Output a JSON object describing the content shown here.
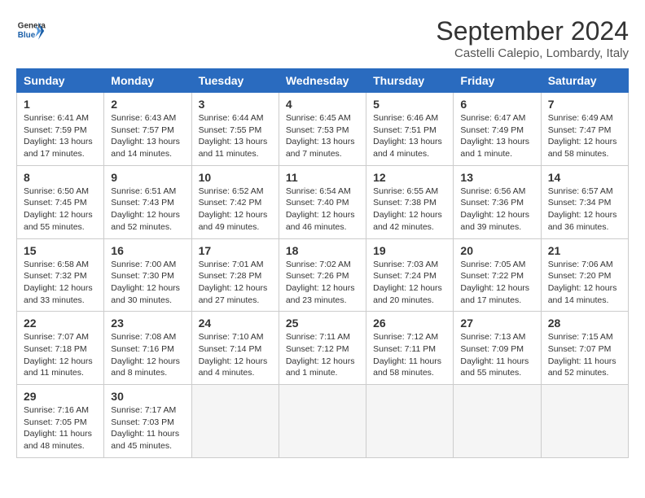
{
  "header": {
    "logo_line1": "General",
    "logo_line2": "Blue",
    "month": "September 2024",
    "location": "Castelli Calepio, Lombardy, Italy"
  },
  "columns": [
    "Sunday",
    "Monday",
    "Tuesday",
    "Wednesday",
    "Thursday",
    "Friday",
    "Saturday"
  ],
  "weeks": [
    [
      {
        "day": "1",
        "info": "Sunrise: 6:41 AM\nSunset: 7:59 PM\nDaylight: 13 hours\nand 17 minutes."
      },
      {
        "day": "2",
        "info": "Sunrise: 6:43 AM\nSunset: 7:57 PM\nDaylight: 13 hours\nand 14 minutes."
      },
      {
        "day": "3",
        "info": "Sunrise: 6:44 AM\nSunset: 7:55 PM\nDaylight: 13 hours\nand 11 minutes."
      },
      {
        "day": "4",
        "info": "Sunrise: 6:45 AM\nSunset: 7:53 PM\nDaylight: 13 hours\nand 7 minutes."
      },
      {
        "day": "5",
        "info": "Sunrise: 6:46 AM\nSunset: 7:51 PM\nDaylight: 13 hours\nand 4 minutes."
      },
      {
        "day": "6",
        "info": "Sunrise: 6:47 AM\nSunset: 7:49 PM\nDaylight: 13 hours\nand 1 minute."
      },
      {
        "day": "7",
        "info": "Sunrise: 6:49 AM\nSunset: 7:47 PM\nDaylight: 12 hours\nand 58 minutes."
      }
    ],
    [
      {
        "day": "8",
        "info": "Sunrise: 6:50 AM\nSunset: 7:45 PM\nDaylight: 12 hours\nand 55 minutes."
      },
      {
        "day": "9",
        "info": "Sunrise: 6:51 AM\nSunset: 7:43 PM\nDaylight: 12 hours\nand 52 minutes."
      },
      {
        "day": "10",
        "info": "Sunrise: 6:52 AM\nSunset: 7:42 PM\nDaylight: 12 hours\nand 49 minutes."
      },
      {
        "day": "11",
        "info": "Sunrise: 6:54 AM\nSunset: 7:40 PM\nDaylight: 12 hours\nand 46 minutes."
      },
      {
        "day": "12",
        "info": "Sunrise: 6:55 AM\nSunset: 7:38 PM\nDaylight: 12 hours\nand 42 minutes."
      },
      {
        "day": "13",
        "info": "Sunrise: 6:56 AM\nSunset: 7:36 PM\nDaylight: 12 hours\nand 39 minutes."
      },
      {
        "day": "14",
        "info": "Sunrise: 6:57 AM\nSunset: 7:34 PM\nDaylight: 12 hours\nand 36 minutes."
      }
    ],
    [
      {
        "day": "15",
        "info": "Sunrise: 6:58 AM\nSunset: 7:32 PM\nDaylight: 12 hours\nand 33 minutes."
      },
      {
        "day": "16",
        "info": "Sunrise: 7:00 AM\nSunset: 7:30 PM\nDaylight: 12 hours\nand 30 minutes."
      },
      {
        "day": "17",
        "info": "Sunrise: 7:01 AM\nSunset: 7:28 PM\nDaylight: 12 hours\nand 27 minutes."
      },
      {
        "day": "18",
        "info": "Sunrise: 7:02 AM\nSunset: 7:26 PM\nDaylight: 12 hours\nand 23 minutes."
      },
      {
        "day": "19",
        "info": "Sunrise: 7:03 AM\nSunset: 7:24 PM\nDaylight: 12 hours\nand 20 minutes."
      },
      {
        "day": "20",
        "info": "Sunrise: 7:05 AM\nSunset: 7:22 PM\nDaylight: 12 hours\nand 17 minutes."
      },
      {
        "day": "21",
        "info": "Sunrise: 7:06 AM\nSunset: 7:20 PM\nDaylight: 12 hours\nand 14 minutes."
      }
    ],
    [
      {
        "day": "22",
        "info": "Sunrise: 7:07 AM\nSunset: 7:18 PM\nDaylight: 12 hours\nand 11 minutes."
      },
      {
        "day": "23",
        "info": "Sunrise: 7:08 AM\nSunset: 7:16 PM\nDaylight: 12 hours\nand 8 minutes."
      },
      {
        "day": "24",
        "info": "Sunrise: 7:10 AM\nSunset: 7:14 PM\nDaylight: 12 hours\nand 4 minutes."
      },
      {
        "day": "25",
        "info": "Sunrise: 7:11 AM\nSunset: 7:12 PM\nDaylight: 12 hours\nand 1 minute."
      },
      {
        "day": "26",
        "info": "Sunrise: 7:12 AM\nSunset: 7:11 PM\nDaylight: 11 hours\nand 58 minutes."
      },
      {
        "day": "27",
        "info": "Sunrise: 7:13 AM\nSunset: 7:09 PM\nDaylight: 11 hours\nand 55 minutes."
      },
      {
        "day": "28",
        "info": "Sunrise: 7:15 AM\nSunset: 7:07 PM\nDaylight: 11 hours\nand 52 minutes."
      }
    ],
    [
      {
        "day": "29",
        "info": "Sunrise: 7:16 AM\nSunset: 7:05 PM\nDaylight: 11 hours\nand 48 minutes."
      },
      {
        "day": "30",
        "info": "Sunrise: 7:17 AM\nSunset: 7:03 PM\nDaylight: 11 hours\nand 45 minutes."
      },
      {
        "day": "",
        "info": ""
      },
      {
        "day": "",
        "info": ""
      },
      {
        "day": "",
        "info": ""
      },
      {
        "day": "",
        "info": ""
      },
      {
        "day": "",
        "info": ""
      }
    ]
  ]
}
